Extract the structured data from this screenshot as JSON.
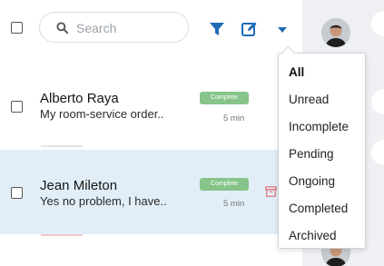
{
  "search": {
    "placeholder": "Search",
    "value": ""
  },
  "toolbar": {
    "filter_icon": "filter-icon",
    "compose_icon": "compose-icon",
    "dropdown_icon": "caret-down-icon",
    "accent_color": "#1f6bb5"
  },
  "conversations": [
    {
      "name": "Alberto Raya",
      "preview": "My room-service order..",
      "status": "Complete",
      "time": "5 min",
      "selected": false
    },
    {
      "name": "Jean Mileton",
      "preview": "Yes no problem, I have..",
      "status": "Complete",
      "time": "5 min",
      "selected": true
    }
  ],
  "filter_menu": {
    "items": [
      {
        "label": "All",
        "active": true
      },
      {
        "label": "Unread",
        "active": false
      },
      {
        "label": "Incomplete",
        "active": false
      },
      {
        "label": "Pending",
        "active": false
      },
      {
        "label": "Ongoing",
        "active": false
      },
      {
        "label": "Completed",
        "active": false
      },
      {
        "label": "Archived",
        "active": false
      }
    ]
  },
  "colors": {
    "status_complete": "#86c48a",
    "selected_row": "#e2eef7",
    "archive_icon": "#e07a80",
    "rail": "#eef0f3"
  }
}
